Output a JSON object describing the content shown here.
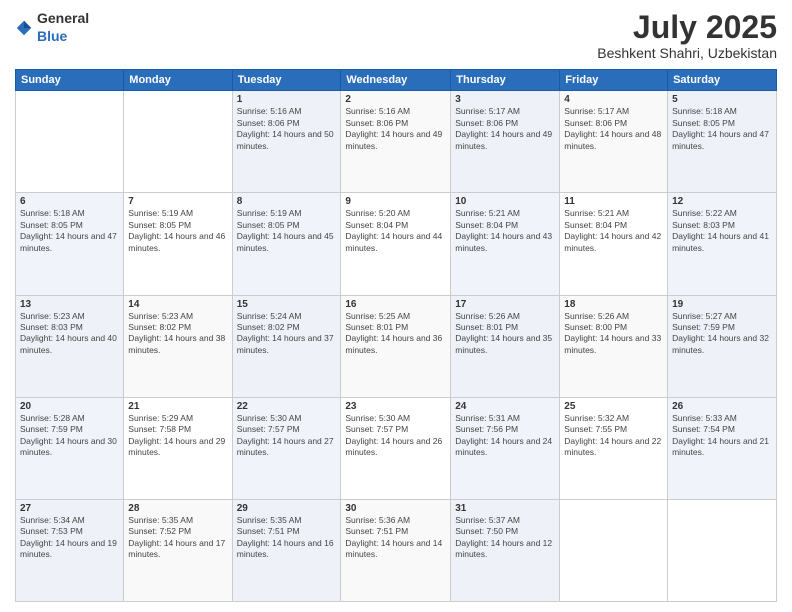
{
  "logo": {
    "general": "General",
    "blue": "Blue"
  },
  "title": "July 2025",
  "subtitle": "Beshkent Shahri, Uzbekistan",
  "days_of_week": [
    "Sunday",
    "Monday",
    "Tuesday",
    "Wednesday",
    "Thursday",
    "Friday",
    "Saturday"
  ],
  "weeks": [
    [
      {
        "day": "",
        "sunrise": "",
        "sunset": "",
        "daylight": ""
      },
      {
        "day": "",
        "sunrise": "",
        "sunset": "",
        "daylight": ""
      },
      {
        "day": "1",
        "sunrise": "Sunrise: 5:16 AM",
        "sunset": "Sunset: 8:06 PM",
        "daylight": "Daylight: 14 hours and 50 minutes."
      },
      {
        "day": "2",
        "sunrise": "Sunrise: 5:16 AM",
        "sunset": "Sunset: 8:06 PM",
        "daylight": "Daylight: 14 hours and 49 minutes."
      },
      {
        "day": "3",
        "sunrise": "Sunrise: 5:17 AM",
        "sunset": "Sunset: 8:06 PM",
        "daylight": "Daylight: 14 hours and 49 minutes."
      },
      {
        "day": "4",
        "sunrise": "Sunrise: 5:17 AM",
        "sunset": "Sunset: 8:06 PM",
        "daylight": "Daylight: 14 hours and 48 minutes."
      },
      {
        "day": "5",
        "sunrise": "Sunrise: 5:18 AM",
        "sunset": "Sunset: 8:05 PM",
        "daylight": "Daylight: 14 hours and 47 minutes."
      }
    ],
    [
      {
        "day": "6",
        "sunrise": "Sunrise: 5:18 AM",
        "sunset": "Sunset: 8:05 PM",
        "daylight": "Daylight: 14 hours and 47 minutes."
      },
      {
        "day": "7",
        "sunrise": "Sunrise: 5:19 AM",
        "sunset": "Sunset: 8:05 PM",
        "daylight": "Daylight: 14 hours and 46 minutes."
      },
      {
        "day": "8",
        "sunrise": "Sunrise: 5:19 AM",
        "sunset": "Sunset: 8:05 PM",
        "daylight": "Daylight: 14 hours and 45 minutes."
      },
      {
        "day": "9",
        "sunrise": "Sunrise: 5:20 AM",
        "sunset": "Sunset: 8:04 PM",
        "daylight": "Daylight: 14 hours and 44 minutes."
      },
      {
        "day": "10",
        "sunrise": "Sunrise: 5:21 AM",
        "sunset": "Sunset: 8:04 PM",
        "daylight": "Daylight: 14 hours and 43 minutes."
      },
      {
        "day": "11",
        "sunrise": "Sunrise: 5:21 AM",
        "sunset": "Sunset: 8:04 PM",
        "daylight": "Daylight: 14 hours and 42 minutes."
      },
      {
        "day": "12",
        "sunrise": "Sunrise: 5:22 AM",
        "sunset": "Sunset: 8:03 PM",
        "daylight": "Daylight: 14 hours and 41 minutes."
      }
    ],
    [
      {
        "day": "13",
        "sunrise": "Sunrise: 5:23 AM",
        "sunset": "Sunset: 8:03 PM",
        "daylight": "Daylight: 14 hours and 40 minutes."
      },
      {
        "day": "14",
        "sunrise": "Sunrise: 5:23 AM",
        "sunset": "Sunset: 8:02 PM",
        "daylight": "Daylight: 14 hours and 38 minutes."
      },
      {
        "day": "15",
        "sunrise": "Sunrise: 5:24 AM",
        "sunset": "Sunset: 8:02 PM",
        "daylight": "Daylight: 14 hours and 37 minutes."
      },
      {
        "day": "16",
        "sunrise": "Sunrise: 5:25 AM",
        "sunset": "Sunset: 8:01 PM",
        "daylight": "Daylight: 14 hours and 36 minutes."
      },
      {
        "day": "17",
        "sunrise": "Sunrise: 5:26 AM",
        "sunset": "Sunset: 8:01 PM",
        "daylight": "Daylight: 14 hours and 35 minutes."
      },
      {
        "day": "18",
        "sunrise": "Sunrise: 5:26 AM",
        "sunset": "Sunset: 8:00 PM",
        "daylight": "Daylight: 14 hours and 33 minutes."
      },
      {
        "day": "19",
        "sunrise": "Sunrise: 5:27 AM",
        "sunset": "Sunset: 7:59 PM",
        "daylight": "Daylight: 14 hours and 32 minutes."
      }
    ],
    [
      {
        "day": "20",
        "sunrise": "Sunrise: 5:28 AM",
        "sunset": "Sunset: 7:59 PM",
        "daylight": "Daylight: 14 hours and 30 minutes."
      },
      {
        "day": "21",
        "sunrise": "Sunrise: 5:29 AM",
        "sunset": "Sunset: 7:58 PM",
        "daylight": "Daylight: 14 hours and 29 minutes."
      },
      {
        "day": "22",
        "sunrise": "Sunrise: 5:30 AM",
        "sunset": "Sunset: 7:57 PM",
        "daylight": "Daylight: 14 hours and 27 minutes."
      },
      {
        "day": "23",
        "sunrise": "Sunrise: 5:30 AM",
        "sunset": "Sunset: 7:57 PM",
        "daylight": "Daylight: 14 hours and 26 minutes."
      },
      {
        "day": "24",
        "sunrise": "Sunrise: 5:31 AM",
        "sunset": "Sunset: 7:56 PM",
        "daylight": "Daylight: 14 hours and 24 minutes."
      },
      {
        "day": "25",
        "sunrise": "Sunrise: 5:32 AM",
        "sunset": "Sunset: 7:55 PM",
        "daylight": "Daylight: 14 hours and 22 minutes."
      },
      {
        "day": "26",
        "sunrise": "Sunrise: 5:33 AM",
        "sunset": "Sunset: 7:54 PM",
        "daylight": "Daylight: 14 hours and 21 minutes."
      }
    ],
    [
      {
        "day": "27",
        "sunrise": "Sunrise: 5:34 AM",
        "sunset": "Sunset: 7:53 PM",
        "daylight": "Daylight: 14 hours and 19 minutes."
      },
      {
        "day": "28",
        "sunrise": "Sunrise: 5:35 AM",
        "sunset": "Sunset: 7:52 PM",
        "daylight": "Daylight: 14 hours and 17 minutes."
      },
      {
        "day": "29",
        "sunrise": "Sunrise: 5:35 AM",
        "sunset": "Sunset: 7:51 PM",
        "daylight": "Daylight: 14 hours and 16 minutes."
      },
      {
        "day": "30",
        "sunrise": "Sunrise: 5:36 AM",
        "sunset": "Sunset: 7:51 PM",
        "daylight": "Daylight: 14 hours and 14 minutes."
      },
      {
        "day": "31",
        "sunrise": "Sunrise: 5:37 AM",
        "sunset": "Sunset: 7:50 PM",
        "daylight": "Daylight: 14 hours and 12 minutes."
      },
      {
        "day": "",
        "sunrise": "",
        "sunset": "",
        "daylight": ""
      },
      {
        "day": "",
        "sunrise": "",
        "sunset": "",
        "daylight": ""
      }
    ]
  ]
}
